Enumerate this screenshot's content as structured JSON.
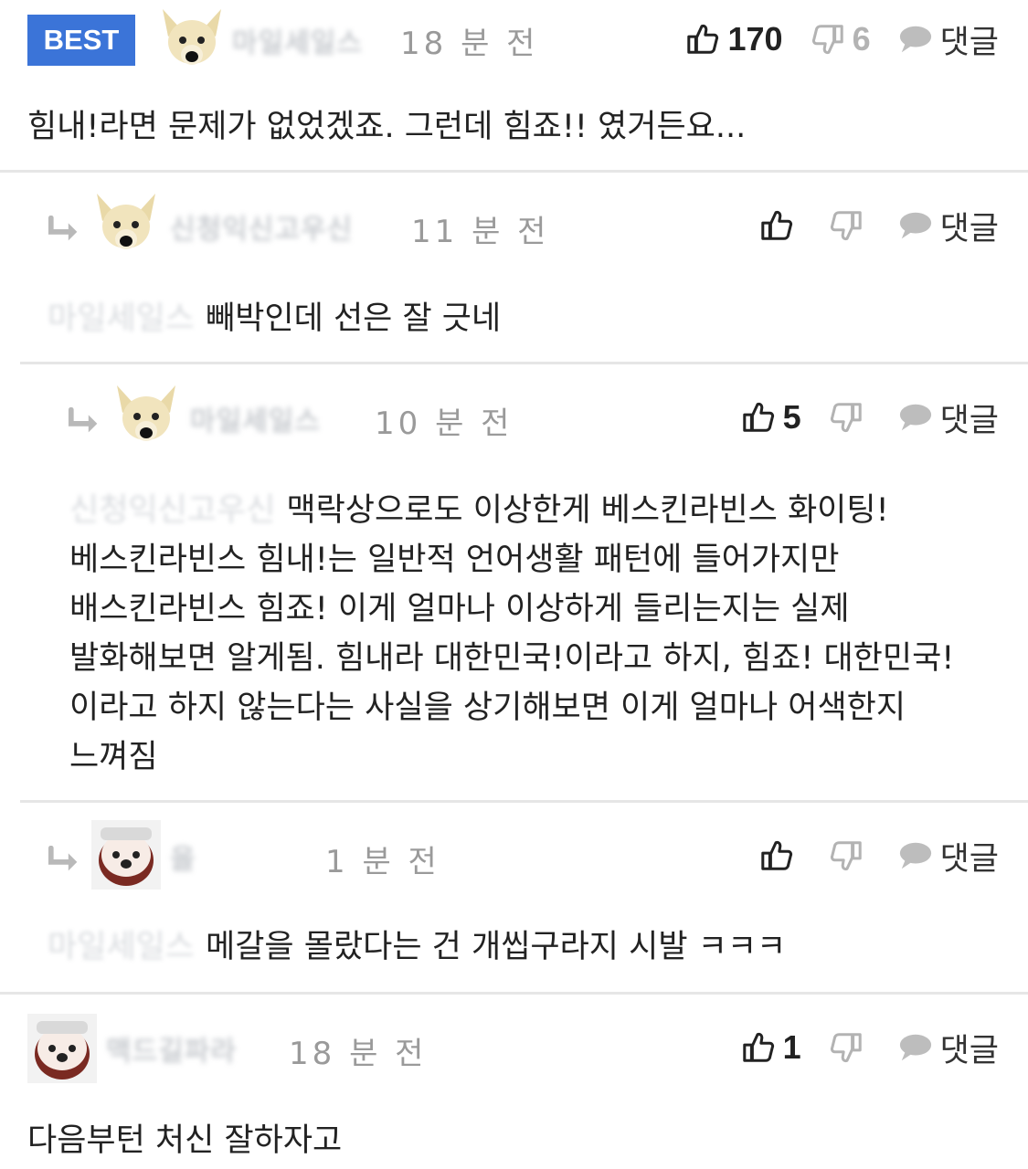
{
  "comments": [
    {
      "best_label": "BEST",
      "author_masked": "마일세일스",
      "time": "18 분 전",
      "likes": "170",
      "dislikes": "6",
      "reply_label": "댓글",
      "text": "힘내!라면 문제가 없었겠죠. 그런데 힘죠!! 였거든요..."
    },
    {
      "author_masked": "신청익신고우신",
      "time": "11 분 전",
      "reply_label": "댓글",
      "mention_masked": "마일세일스",
      "text": "빼박인데 선은 잘 긋네"
    },
    {
      "author_masked": "마일세일스",
      "time": "10 분 전",
      "likes": "5",
      "reply_label": "댓글",
      "mention_masked": "신청익신고우신",
      "text": "맥락상으로도 이상한게 베스킨라빈스 화이팅! 베스킨라빈스 힘내!는 일반적 언어생활 패턴에 들어가지만 배스킨라빈스 힘죠! 이게 얼마나 이상하게 들리는지는 실제 발화해보면 알게됨. 힘내라 대한민국!이라고 하지, 힘죠! 대한민국! 이라고 하지 않는다는 사실을 상기해보면 이게 얼마나 어색한지 느껴짐"
    },
    {
      "author_masked": "을",
      "time": "1 분 전",
      "reply_label": "댓글",
      "mention_masked": "마일세일스",
      "text": "메갈을 몰랐다는 건 개씹구라지 시발 ㅋㅋㅋ"
    },
    {
      "author_masked": "맥드길파라",
      "time": "18 분 전",
      "likes": "1",
      "reply_label": "댓글",
      "text": "다음부턴 처신 잘하자고"
    }
  ],
  "icons": {
    "like": "thumbs-up-icon",
    "dislike": "thumbs-down-icon",
    "reply": "speech-bubble-icon",
    "reply_arrow": "reply-arrow-icon"
  },
  "colors": {
    "best_badge": "#3b74d8",
    "divider": "#e6e6e6",
    "time_text": "#9a9a9a",
    "muted_icon": "#b3b3b3"
  }
}
